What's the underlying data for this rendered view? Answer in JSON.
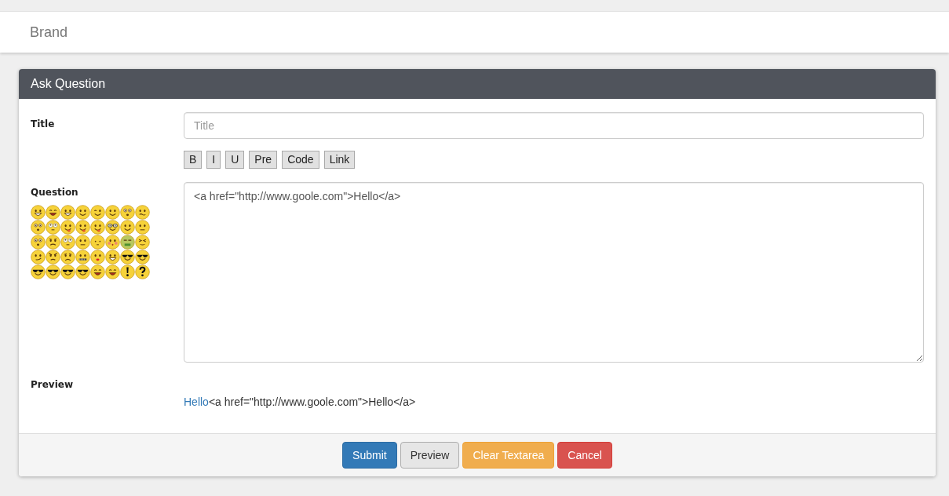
{
  "navbar": {
    "brand": "Brand"
  },
  "panel": {
    "title": "Ask Question"
  },
  "form": {
    "title_field": {
      "label": "Title",
      "placeholder": "Title"
    },
    "format_buttons": [
      "B",
      "I",
      "U",
      "Pre",
      "Code",
      "Link"
    ],
    "question_field": {
      "label": "Question",
      "value": "<a href=\"http://www.goole.com\">Hello</a>"
    },
    "preview": {
      "label": "Preview",
      "link": "Hello",
      "text": "<a href=\"http://www.goole.com\">Hello</a>"
    }
  },
  "footer_buttons": [
    {
      "label": "Submit",
      "kind": "primary"
    },
    {
      "label": "Preview",
      "kind": "default"
    },
    {
      "label": "Clear Textarea",
      "kind": "warning"
    },
    {
      "label": "Cancel",
      "kind": "danger"
    }
  ]
}
